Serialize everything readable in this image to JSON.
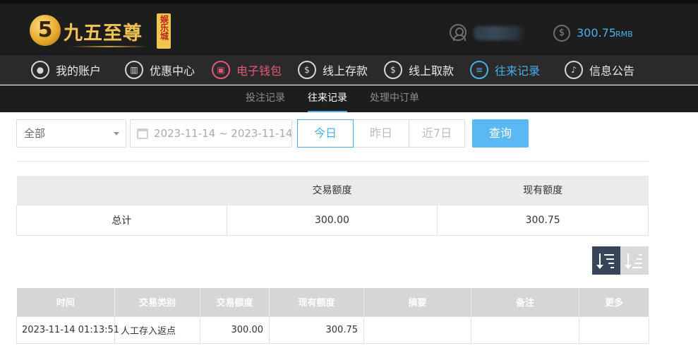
{
  "header": {
    "logo_mark": "5",
    "logo_text": "九五至尊",
    "logo_seal": "娱乐城",
    "balance": {
      "value": "300.75",
      "unit": "RMB"
    }
  },
  "nav": [
    {
      "label": "我的账户",
      "icon": "user-icon"
    },
    {
      "label": "优惠中心",
      "icon": "gift-icon"
    },
    {
      "label": "电子钱包",
      "icon": "wallet-icon"
    },
    {
      "label": "线上存款",
      "icon": "deposit-icon"
    },
    {
      "label": "线上取款",
      "icon": "withdraw-icon"
    },
    {
      "label": "往来记录",
      "icon": "record-icon"
    },
    {
      "label": "信息公告",
      "icon": "bell-icon"
    }
  ],
  "subnav": [
    "投注记录",
    "往来记录",
    "处理中订单"
  ],
  "filters": {
    "type_selected": "全部",
    "date_range": "2023-11-14 ~ 2023-11-14",
    "quick": [
      "今日",
      "昨日",
      "近7日"
    ],
    "query_label": "查询"
  },
  "summary": {
    "headers": [
      "",
      "交易额度",
      "现有额度"
    ],
    "row": [
      "总计",
      "300.00",
      "300.75"
    ]
  },
  "records": {
    "headers": [
      "时间",
      "交易类别",
      "交易额度",
      "现有额度",
      "摘要",
      "备注",
      "更多"
    ],
    "rows": [
      [
        "2023-11-14 01:13:51",
        "人工存入返点",
        "300.00",
        "300.75",
        "",
        "",
        ""
      ]
    ]
  },
  "colors": {
    "accent": "#48aef0",
    "wallet": "#e8567a",
    "sort_active": "#37455a"
  }
}
